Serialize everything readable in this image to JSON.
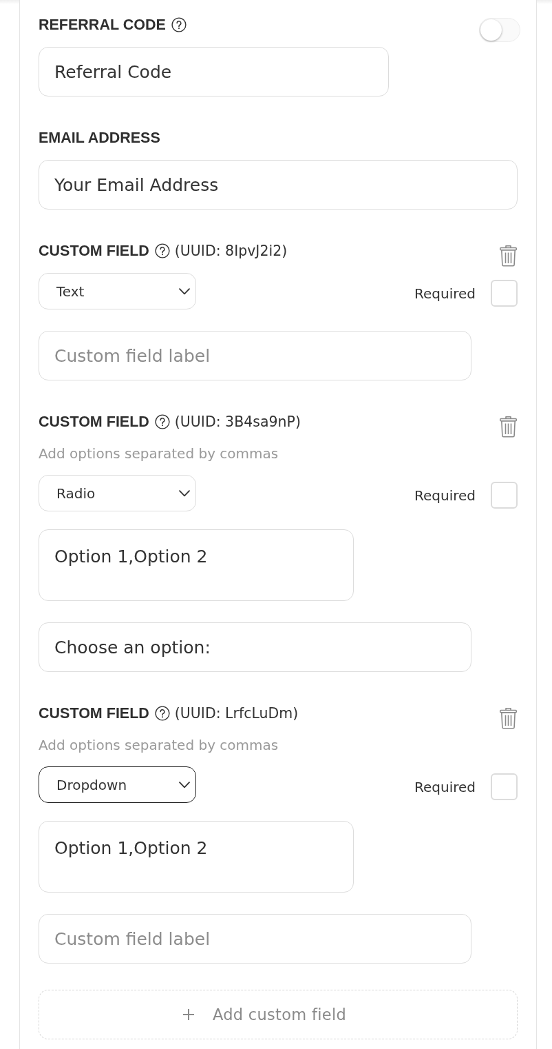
{
  "fields": [
    {
      "kind": "referral",
      "label": "REFERRAL CODE",
      "help": true,
      "toggle": {
        "on": false
      },
      "input": {
        "value": "Referral Code"
      }
    },
    {
      "kind": "email",
      "label": "EMAIL ADDRESS",
      "help": false,
      "input": {
        "value": "Your Email Address"
      }
    },
    {
      "kind": "custom",
      "label": "CUSTOM FIELD",
      "help": true,
      "uuid": "(UUID: 8IpvJ2i2)",
      "type_select": {
        "value": "Text",
        "focused": false
      },
      "required": {
        "label": "Required",
        "checked": false
      },
      "input": {
        "placeholder": "Custom field label"
      }
    },
    {
      "kind": "custom",
      "label": "CUSTOM FIELD",
      "help": true,
      "uuid": "(UUID: 3B4sa9nP)",
      "hint": "Add options separated by commas",
      "type_select": {
        "value": "Radio",
        "focused": false
      },
      "required": {
        "label": "Required",
        "checked": false
      },
      "options": {
        "value": "Option 1,Option 2"
      },
      "input": {
        "value": "Choose an option:"
      }
    },
    {
      "kind": "custom",
      "label": "CUSTOM FIELD",
      "help": true,
      "uuid": "(UUID: LrfcLuDm)",
      "hint": "Add options separated by commas",
      "type_select": {
        "value": "Dropdown",
        "focused": true
      },
      "required": {
        "label": "Required",
        "checked": false
      },
      "options": {
        "value": "Option 1,Option 2"
      },
      "input": {
        "placeholder": "Custom field label"
      }
    }
  ],
  "add_button": {
    "label": "Add custom field"
  }
}
